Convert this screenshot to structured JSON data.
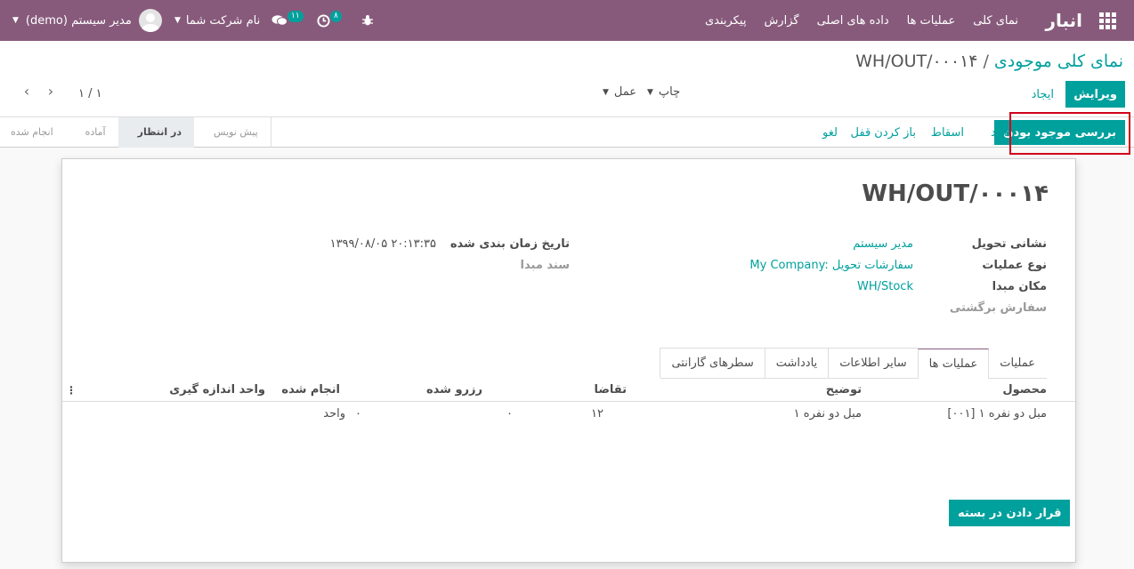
{
  "navbar": {
    "brand": "انبار",
    "menu": [
      "نمای کلی",
      "عملیات ها",
      "داده های اصلی",
      "گزارش",
      "پیکربندی"
    ],
    "activity_count": "۸",
    "message_count": "۱۱",
    "company": "نام شرکت شما",
    "user": "مدیر سیستم (demo)"
  },
  "breadcrumb": {
    "parent": "نمای کلی موجودی",
    "separator": "/",
    "current": "WH/OUT/۰۰۰۱۴"
  },
  "buttons": {
    "edit": "ویرایش",
    "create": "ایجاد",
    "print": "چاپ",
    "action": "عمل"
  },
  "pager": {
    "value": "۱ / ۱"
  },
  "statusbar": {
    "check_availability": "بررسی موجود بودن",
    "confirm": "تأیید",
    "scrap": "اسقاط",
    "unlock": "باز کردن قفل",
    "cancel": "لغو",
    "stages": [
      "انجام شده",
      "آماده",
      "در انتظار",
      "پیش نویس"
    ],
    "active_stage": "در انتظار"
  },
  "record": {
    "name": "WH/OUT/۰۰۰۱۴",
    "left": [
      {
        "label": "نشانی تحویل",
        "value": "مدیر سیستم"
      },
      {
        "label": "نوع عملیات",
        "value": "My Company: سفارشات تحویل"
      },
      {
        "label": "مکان مبدا",
        "value": "WH/Stock"
      },
      {
        "label": "سفارش برگشتی",
        "value": ""
      }
    ],
    "right": [
      {
        "label": "تاریخ زمان بندی شده",
        "value": "۱۳۹۹/۰۸/۰۵ ۲۰:۱۳:۳۵"
      },
      {
        "label": "سند مبدا",
        "value": ""
      }
    ]
  },
  "tabs": [
    "عملیات",
    "عملیات ها",
    "سایر اطلاعات",
    "یادداشت",
    "سطرهای گارانتی"
  ],
  "table": {
    "headers": {
      "product": "محصول",
      "description": "توضیح",
      "demand": "تقاضا",
      "reserved": "رزرو شده",
      "done": "انجام شده",
      "uom": "واحد اندازه گیری"
    },
    "rows": [
      {
        "product": "[۰۰۱] مبل دو نفره ۱",
        "description": "مبل دو نفره ۱",
        "demand": "۱۲",
        "reserved": "۰",
        "done": "۰",
        "uom": "واحد"
      }
    ]
  },
  "put_in_pack": "قرار دادن در بسته",
  "colors": {
    "navbar": "#875a7b",
    "accent": "#00a09d"
  }
}
